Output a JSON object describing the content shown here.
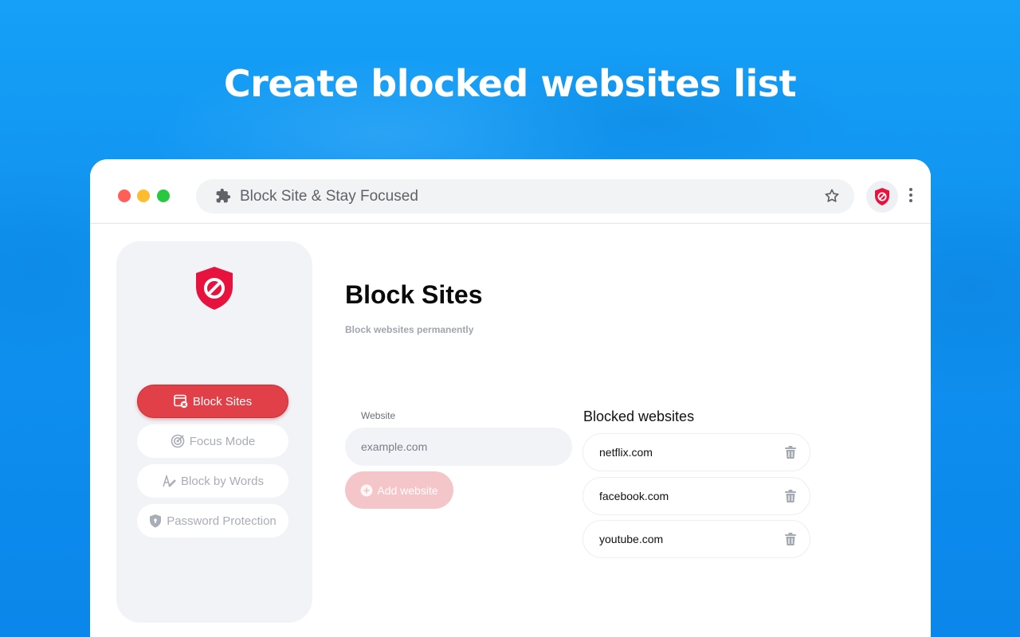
{
  "headline": "Create blocked websites list",
  "browser": {
    "address_text": "Block Site & Stay Focused",
    "icons": {
      "extensions": "puzzle-icon",
      "bookmark": "star-icon",
      "extension_button": "blocksite-shield-icon",
      "menu": "kebab-menu-icon"
    }
  },
  "sidebar": {
    "items": [
      {
        "label": "Block Sites",
        "icon": "block-sites-icon",
        "active": true
      },
      {
        "label": "Focus Mode",
        "icon": "target-icon",
        "active": false
      },
      {
        "label": "Block by Words",
        "icon": "pen-icon",
        "active": false
      },
      {
        "label": "Password Protection",
        "icon": "lock-shield-icon",
        "active": false
      }
    ]
  },
  "main": {
    "title": "Block Sites",
    "subtitle": "Block websites permanently",
    "form": {
      "label": "Website",
      "placeholder": "example.com",
      "add_button": "Add website"
    },
    "blocked": {
      "title": "Blocked websites",
      "items": [
        "netflix.com",
        "facebook.com",
        "youtube.com"
      ]
    }
  },
  "colors": {
    "background": "#1098f3",
    "accent": "#e14048",
    "add_button_disabled": "#f5c6c9"
  }
}
